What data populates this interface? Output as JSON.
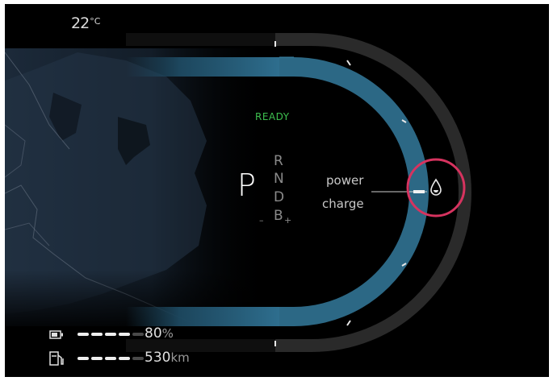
{
  "status": {
    "outside_temp": "22",
    "temp_unit": "°C"
  },
  "drive": {
    "ready_label": "READY",
    "selected_gear": "P",
    "gears": [
      "R",
      "N",
      "D",
      "B"
    ],
    "regen_minus": "–",
    "regen_plus": "+"
  },
  "gauge": {
    "power_label": "power",
    "charge_label": "charge",
    "indicator_icon": "drop-icon",
    "highlight_color": "#d6335f",
    "arc_color": "#2f6f8c"
  },
  "footer": {
    "battery_percent": "80",
    "battery_unit": "%",
    "battery_level": 0.8,
    "range_value": "530",
    "range_unit": "km",
    "range_level": 0.8
  },
  "icons": [
    "battery-icon",
    "fuel-pump-icon",
    "drop-icon"
  ]
}
